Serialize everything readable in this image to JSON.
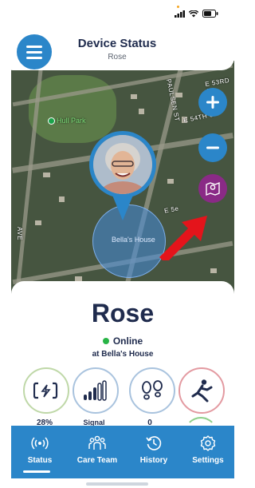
{
  "header": {
    "title": "Device Status",
    "subtitle": "Rose"
  },
  "map": {
    "park_label": "Hull Park",
    "geofence_label": "Bella's House",
    "street_labels": [
      "E 53RD S",
      "E 54TH ST",
      "PAULSEN ST",
      "E 5e",
      "AVE"
    ]
  },
  "profile": {
    "name": "Rose",
    "status": "Online",
    "location": "at Bella's House"
  },
  "metrics": [
    {
      "icon": "battery-icon",
      "label": "28%"
    },
    {
      "icon": "signal-icon",
      "label": "Signal"
    },
    {
      "icon": "footsteps-icon",
      "label": "0"
    },
    {
      "icon": "fall-detection-icon",
      "label": ""
    }
  ],
  "nav": {
    "items": [
      {
        "label": "Status",
        "icon": "broadcast-icon",
        "active": true
      },
      {
        "label": "Care Team",
        "icon": "team-icon",
        "active": false
      },
      {
        "label": "History",
        "icon": "history-icon",
        "active": false
      },
      {
        "label": "Settings",
        "icon": "gear-icon",
        "active": false
      }
    ]
  },
  "colors": {
    "primary": "#2b86c9",
    "layers": "#8a2a86",
    "online": "#28b446",
    "text": "#1f2b4d",
    "arrow": "#e4141b"
  }
}
